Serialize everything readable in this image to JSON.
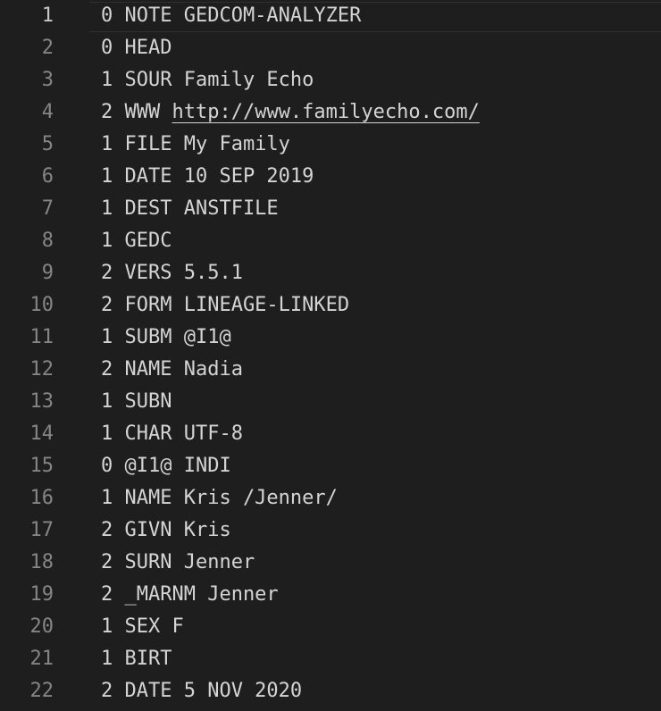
{
  "editor": {
    "lines": [
      {
        "number": "1",
        "text": "0 NOTE GEDCOM-ANALYZER"
      },
      {
        "number": "2",
        "text": "0 HEAD"
      },
      {
        "number": "3",
        "text": "1 SOUR Family Echo"
      },
      {
        "number": "4",
        "prefix": "2 WWW ",
        "link": "http://www.familyecho.com/"
      },
      {
        "number": "5",
        "text": "1 FILE My Family"
      },
      {
        "number": "6",
        "text": "1 DATE 10 SEP 2019"
      },
      {
        "number": "7",
        "text": "1 DEST ANSTFILE"
      },
      {
        "number": "8",
        "text": "1 GEDC"
      },
      {
        "number": "9",
        "text": "2 VERS 5.5.1"
      },
      {
        "number": "10",
        "text": "2 FORM LINEAGE-LINKED"
      },
      {
        "number": "11",
        "text": "1 SUBM @I1@"
      },
      {
        "number": "12",
        "text": "2 NAME Nadia"
      },
      {
        "number": "13",
        "text": "1 SUBN"
      },
      {
        "number": "14",
        "text": "1 CHAR UTF-8"
      },
      {
        "number": "15",
        "text": "0 @I1@ INDI"
      },
      {
        "number": "16",
        "text": "1 NAME Kris /Jenner/"
      },
      {
        "number": "17",
        "text": "2 GIVN Kris"
      },
      {
        "number": "18",
        "text": "2 SURN Jenner"
      },
      {
        "number": "19",
        "text": "2 _MARNM Jenner"
      },
      {
        "number": "20",
        "text": "1 SEX F"
      },
      {
        "number": "21",
        "text": "1 BIRT"
      },
      {
        "number": "22",
        "text": "2 DATE 5 NOV 2020"
      }
    ]
  }
}
